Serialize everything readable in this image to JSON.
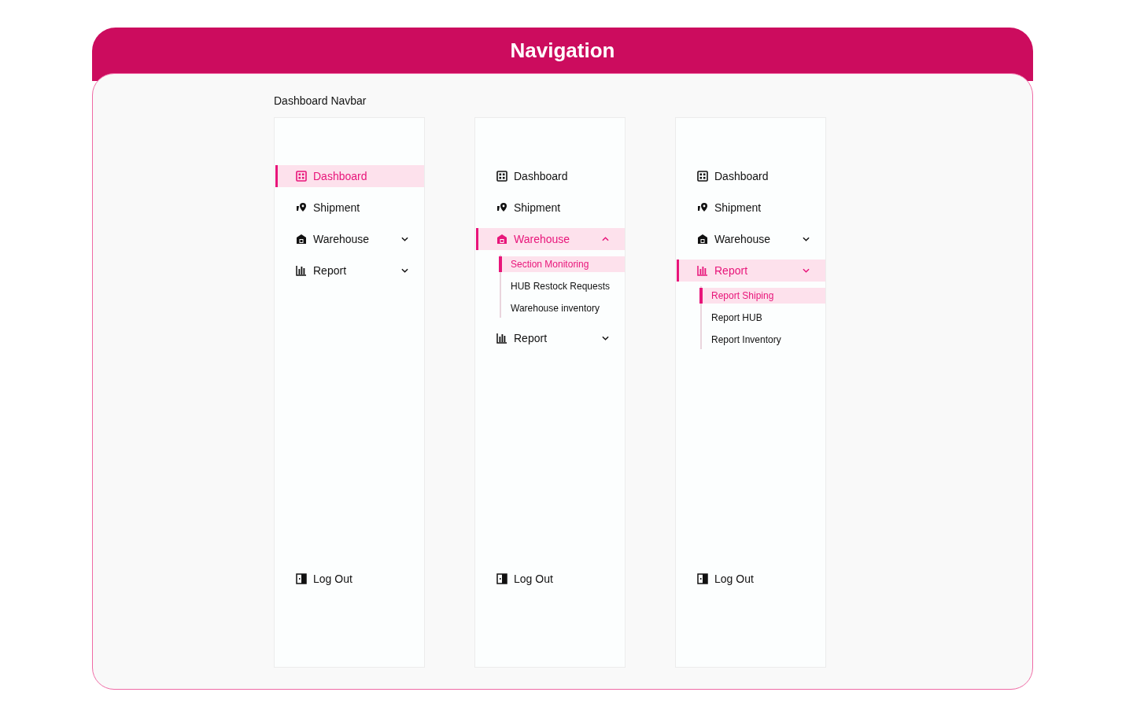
{
  "header": {
    "title": "Navigation"
  },
  "section_title": "Dashboard Navbar",
  "navbars": [
    {
      "items": [
        {
          "kind": "dashboard",
          "label": "Dashboard",
          "selected": true
        },
        {
          "kind": "shipment",
          "label": "Shipment",
          "selected": false
        },
        {
          "kind": "warehouse",
          "label": "Warehouse",
          "selected": false,
          "expanded": false
        },
        {
          "kind": "report",
          "label": "Report",
          "selected": false,
          "expanded": false
        }
      ],
      "logout": {
        "label": "Log Out"
      }
    },
    {
      "items": [
        {
          "kind": "dashboard",
          "label": "Dashboard",
          "selected": false
        },
        {
          "kind": "shipment",
          "label": "Shipment",
          "selected": false
        },
        {
          "kind": "warehouse",
          "label": "Warehouse",
          "selected": true,
          "expanded": true,
          "children": [
            {
              "label": "Section Monitoring",
              "selected": true
            },
            {
              "label": "HUB Restock Requests",
              "selected": false
            },
            {
              "label": "Warehouse inventory",
              "selected": false
            }
          ]
        },
        {
          "kind": "report",
          "label": "Report",
          "selected": false,
          "expanded": false
        }
      ],
      "logout": {
        "label": "Log Out"
      }
    },
    {
      "items": [
        {
          "kind": "dashboard",
          "label": "Dashboard",
          "selected": false
        },
        {
          "kind": "shipment",
          "label": "Shipment",
          "selected": false
        },
        {
          "kind": "warehouse",
          "label": "Warehouse",
          "selected": false,
          "expanded": false
        },
        {
          "kind": "report",
          "label": "Report",
          "selected": true,
          "expanded": false,
          "children": [
            {
              "label": "Report Shiping",
              "selected": true
            },
            {
              "label": "Report HUB",
              "selected": false
            },
            {
              "label": "Report Inventory",
              "selected": false
            }
          ]
        }
      ],
      "logout": {
        "label": "Log Out"
      }
    }
  ]
}
